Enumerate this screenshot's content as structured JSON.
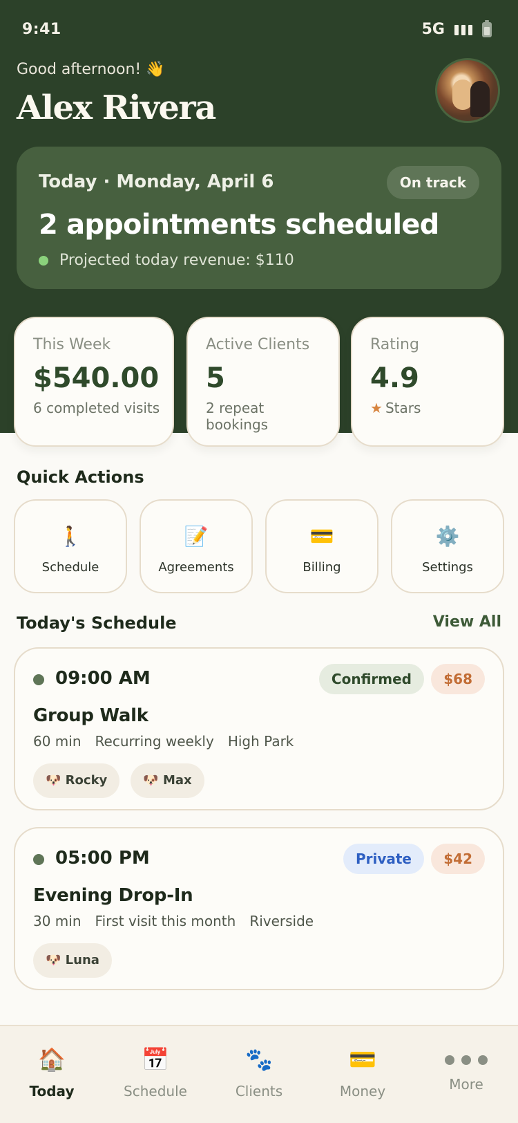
{
  "status_bar": {
    "time": "9:41",
    "network": "5G"
  },
  "header": {
    "greeting": "Good afternoon! 👋",
    "user_name": "Alex Rivera"
  },
  "today_card": {
    "date": "Today · Monday, April 6",
    "status_badge": "On track",
    "title": "2 appointments scheduled",
    "revenue": "Projected today revenue: $110"
  },
  "stats": [
    {
      "label": "This Week",
      "value": "$540.00",
      "sub": "6 completed visits"
    },
    {
      "label": "Active Clients",
      "value": "5",
      "sub": "2 repeat bookings"
    },
    {
      "label": "Rating",
      "value": "4.9",
      "sub": "Stars",
      "icon": "star-icon"
    }
  ],
  "quick_actions": {
    "title": "Quick Actions",
    "items": [
      {
        "label": "Schedule",
        "icon": "walking-person-icon",
        "glyph": "🚶"
      },
      {
        "label": "Agreements",
        "icon": "memo-icon",
        "glyph": "📝"
      },
      {
        "label": "Billing",
        "icon": "credit-card-icon",
        "glyph": "💳"
      },
      {
        "label": "Settings",
        "icon": "gear-icon",
        "glyph": "⚙️"
      }
    ]
  },
  "schedule": {
    "title": "Today's Schedule",
    "view_all": "View All",
    "items": [
      {
        "time": "09:00 AM",
        "status": "Confirmed",
        "price": "$68",
        "title": "Group Walk",
        "duration": "60 min",
        "recurrence": "Recurring weekly",
        "location": "High Park",
        "pets": [
          "🐶 Rocky",
          "🐶 Max"
        ]
      },
      {
        "time": "05:00 PM",
        "status": "Private",
        "price": "$42",
        "title": "Evening Drop-In",
        "duration": "30 min",
        "recurrence": "First visit this month",
        "location": "Riverside",
        "pets": [
          "🐶 Luna"
        ]
      }
    ]
  },
  "colors": {
    "hero_bg": "#2c4129",
    "card_bg": "#47603f",
    "accent_green": "#2f4a2b",
    "price_orange": "#c26d35",
    "private_blue": "#2e5fc2"
  },
  "nav": [
    {
      "label": "Today",
      "icon": "house-icon",
      "glyph": "🏠",
      "active": true
    },
    {
      "label": "Schedule",
      "icon": "calendar-icon",
      "glyph": "📅",
      "active": false
    },
    {
      "label": "Clients",
      "icon": "paw-icon",
      "glyph": "🐾",
      "active": false
    },
    {
      "label": "Money",
      "icon": "credit-card-icon",
      "glyph": "💳",
      "active": false
    },
    {
      "label": "More",
      "icon": "more-dots-icon",
      "active": false
    }
  ]
}
